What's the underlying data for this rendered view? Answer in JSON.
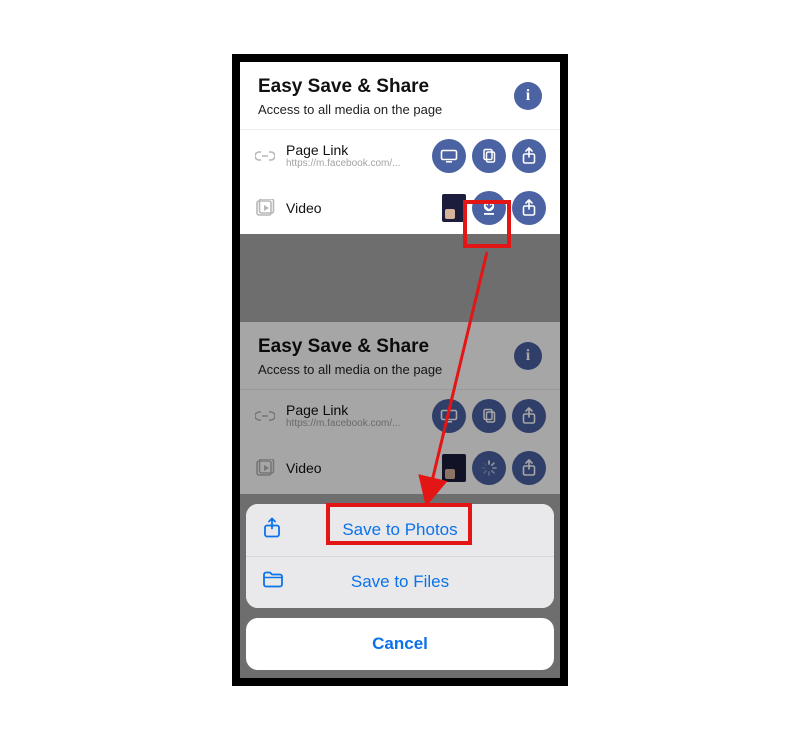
{
  "colors": {
    "primary": "#4b62a3",
    "ios_blue": "#0b72ea",
    "highlight": "#e41515"
  },
  "panel": {
    "title": "Easy Save & Share",
    "subtitle": "Access to all media on the page",
    "info_glyph": "i",
    "rows": {
      "link": {
        "label": "Page Link",
        "url": "https://m.facebook.com/..."
      },
      "video": {
        "label": "Video"
      }
    }
  },
  "sheet": {
    "save_photos": "Save to Photos",
    "save_files": "Save to Files",
    "cancel": "Cancel"
  }
}
